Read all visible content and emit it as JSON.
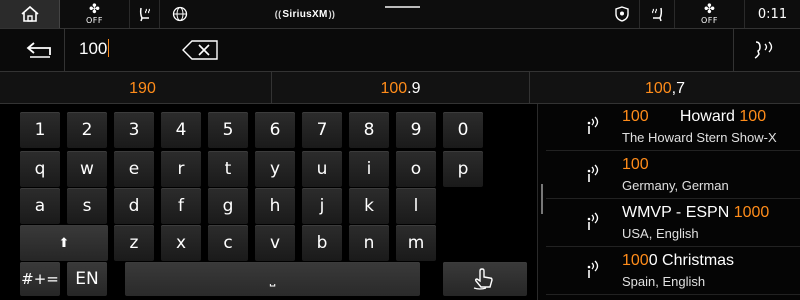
{
  "status_bar": {
    "fan_left_label": "OFF",
    "fan_right_label": "OFF",
    "sirius_logo": "SiriusXM",
    "clock": "0:11"
  },
  "input": {
    "value": "100"
  },
  "suggestions": [
    {
      "pre": "",
      "hl": "190",
      "post": ""
    },
    {
      "pre": "",
      "hl": "100",
      "post": ".9"
    },
    {
      "pre": "",
      "hl": "100",
      "post": ",7"
    }
  ],
  "keyboard": {
    "row_numbers": [
      "1",
      "2",
      "3",
      "4",
      "5",
      "6",
      "7",
      "8",
      "9",
      "0"
    ],
    "row_top": [
      "q",
      "w",
      "e",
      "r",
      "t",
      "y",
      "u",
      "i",
      "o",
      "p"
    ],
    "row_middle": [
      "a",
      "s",
      "d",
      "f",
      "g",
      "h",
      "j",
      "k",
      "l"
    ],
    "row_bottom": [
      "z",
      "x",
      "c",
      "v",
      "b",
      "n",
      "m"
    ],
    "shift_symbol": "⬆",
    "symbols_label": "#+=",
    "language_label": "EN",
    "space_symbol": "⎵"
  },
  "results": [
    {
      "title_pre": "",
      "title_hl": "100",
      "title_mid": "       Howard ",
      "title_hl2": "100",
      "subtitle": "The Howard Stern Show-X"
    },
    {
      "title_pre": "",
      "title_hl": "100",
      "title_mid": "",
      "title_hl2": "",
      "subtitle": "Germany, German"
    },
    {
      "title_pre": "WMVP - ESPN ",
      "title_hl": "1000",
      "title_mid": "",
      "title_hl2": "",
      "subtitle": "USA, English"
    },
    {
      "title_pre": "",
      "title_hl": "100",
      "title_mid": "0 Christmas",
      "title_hl2": "",
      "subtitle": "Spain, English"
    }
  ],
  "colors": {
    "accent": "#ff8c1a",
    "background": "#000000",
    "key": "#262626"
  }
}
